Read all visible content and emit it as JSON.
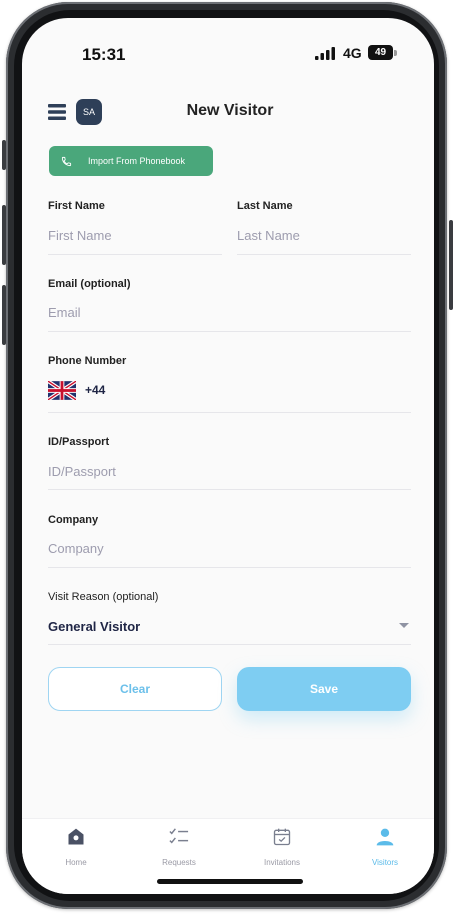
{
  "status_bar": {
    "time": "15:31",
    "network": "4G",
    "battery": "49"
  },
  "header": {
    "avatar_initials": "SA",
    "title": "New Visitor"
  },
  "import_button": {
    "label": "Import From Phonebook"
  },
  "form": {
    "first_name": {
      "label": "First Name",
      "placeholder": "First Name"
    },
    "last_name": {
      "label": "Last Name",
      "placeholder": "Last Name"
    },
    "email": {
      "label": "Email (optional)",
      "placeholder": "Email"
    },
    "phone": {
      "label": "Phone Number",
      "country_code": "+44"
    },
    "id_passport": {
      "label": "ID/Passport",
      "placeholder": "ID/Passport"
    },
    "company": {
      "label": "Company",
      "placeholder": "Company"
    },
    "visit_reason": {
      "label": "Visit Reason (optional)",
      "value": "General Visitor"
    }
  },
  "actions": {
    "clear_label": "Clear",
    "save_label": "Save"
  },
  "tabs": [
    {
      "label": "Home",
      "icon": "home-icon"
    },
    {
      "label": "Requests",
      "icon": "checklist-icon"
    },
    {
      "label": "Invitations",
      "icon": "calendar-check-icon"
    },
    {
      "label": "Visitors",
      "icon": "person-icon",
      "active": true
    }
  ],
  "colors": {
    "accent": "#7ecdf2",
    "import_green": "#4aa77b",
    "avatar": "#2e3f58"
  }
}
